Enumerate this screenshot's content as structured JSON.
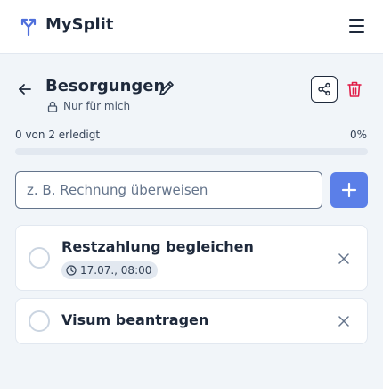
{
  "app": {
    "title": "MySplit",
    "logo_icon": "split-arrows-icon",
    "menu_icon": "hamburger-menu-icon",
    "accent_color": "#5b7fe8"
  },
  "list": {
    "title": "Besorgungen",
    "visibility": "Nur für mich",
    "back_icon": "arrow-left-icon",
    "edit_icon": "pencil-icon",
    "share_icon": "share-icon",
    "delete_icon": "trash-icon",
    "delete_color": "#e11d48"
  },
  "progress": {
    "label": "0 von 2 erledigt",
    "percent_label": "0%",
    "fraction": 0
  },
  "new_task": {
    "placeholder": "z. B. Rechnung überweisen",
    "value": "",
    "add_icon": "plus-icon"
  },
  "tasks": [
    {
      "title": "Restzahlung begleichen",
      "due": "17.07., 08:00",
      "done": false
    },
    {
      "title": "Visum beantragen",
      "due": "",
      "done": false
    }
  ]
}
